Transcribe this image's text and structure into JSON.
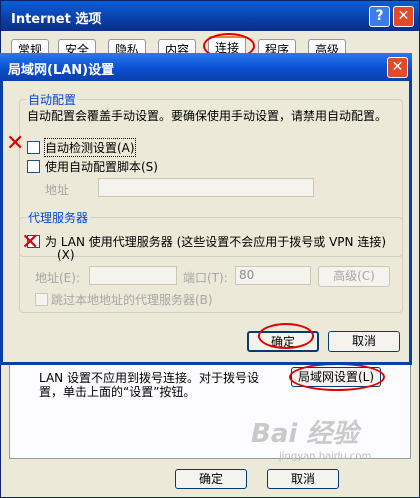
{
  "bg_window": {
    "title": "Internet 选项",
    "help_glyph": "?",
    "close_glyph": "✕",
    "tabs": [
      "常规",
      "安全",
      "隐私",
      "内容",
      "连接",
      "程序",
      "高级"
    ],
    "active_tab": "连接",
    "lan_text_line1": "LAN 设置不应用到拨号连接。对于拨号设",
    "lan_text_line2": "置，单击上面的“设置”按钮。",
    "lan_button": "局域网设置(L)",
    "ok_button": "确定",
    "cancel_button": "取消",
    "watermark": "Bai 经验",
    "watermark_sub": "jingyan.baidu.com"
  },
  "dialog": {
    "title": "局域网(LAN)设置",
    "close_glyph": "✕",
    "auto_config": {
      "group_title": "自动配置",
      "description": "自动配置会覆盖手动设置。要确保使用手动设置，请禁用自动配置。",
      "auto_detect_label": "自动检测设置(A)",
      "auto_detect_checked": false,
      "script_label": "使用自动配置脚本(S)",
      "script_checked": false,
      "address_label": "地址",
      "address_value": ""
    },
    "proxy": {
      "group_title": "代理服务器",
      "use_proxy_label_line1": "为 LAN 使用代理服务器 (这些设置不会应用于拨号或 VPN 连接)",
      "use_proxy_label_line2": "(X)",
      "use_proxy_checked": false,
      "address_label": "地址(E):",
      "address_value": "",
      "port_label": "端口(T):",
      "port_value": "80",
      "advanced_button": "高级(C)",
      "bypass_label": "跳过本地地址的代理服务器(B)",
      "bypass_checked": false
    },
    "ok_button": "确定",
    "cancel_button": "取消"
  },
  "annotations": {
    "cross_mark": "✕"
  }
}
